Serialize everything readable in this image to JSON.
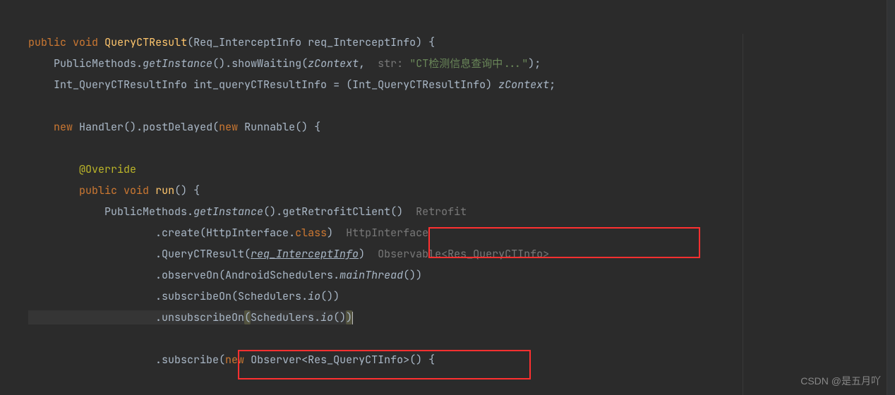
{
  "line1": {
    "kw_public": "public",
    "kw_void": "void",
    "method": "QueryCTResult",
    "param_type": "Req_InterceptInfo",
    "param_name": "req_InterceptInfo",
    "brace": ") {"
  },
  "line2": {
    "cls": "PublicMethods",
    "getInstance": "getInstance",
    "showWaiting": "showWaiting",
    "zContext": "zContext",
    "hint_str": "str:",
    "string_val": "\"CT检测信息查询中...\"",
    "end": ");"
  },
  "line3": {
    "type1": "Int_QueryCTResultInfo",
    "var": "int_queryCTResultInfo",
    "eq": " = ",
    "cast": "(Int_QueryCTResultInfo)",
    "zContext": "zContext",
    "end": ";"
  },
  "line5": {
    "kw_new": "new",
    "Handler": "Handler",
    "postDelayed": "postDelayed",
    "kw_new2": "new",
    "Runnable": "Runnable",
    "end": "() {"
  },
  "line7": {
    "override": "@Override"
  },
  "line8": {
    "kw_public": "public",
    "kw_void": "void",
    "run": "run",
    "end": "() {"
  },
  "line9": {
    "cls": "PublicMethods",
    "getInstance": "getInstance",
    "getRetrofitClient": "getRetrofitClient",
    "hint": "Retrofit"
  },
  "line10": {
    "create": ".create",
    "HttpInterface": "HttpInterface",
    "class_kw": "class",
    "hint": "HttpInterface"
  },
  "line11": {
    "QueryCTResult": ".QueryCTResult",
    "param": "req_InterceptInfo",
    "hint": "Observable<Res_QueryCTInfo>"
  },
  "line12": {
    "observeOn": ".observeOn",
    "AndroidSchedulers": "AndroidSchedulers",
    "mainThread": "mainThread",
    "end": "())"
  },
  "line13": {
    "subscribeOn": ".subscribeOn",
    "Schedulers": "Schedulers",
    "io": "io",
    "end": "())"
  },
  "line14": {
    "unsubscribeOn": ".unsubscribeOn",
    "Schedulers": "Schedulers",
    "io": "io",
    "end": "()"
  },
  "line16": {
    "subscribe": ".subscribe",
    "kw_new": "new",
    "Observer": "Observer",
    "generic": "Res_QueryCTInfo",
    "end": ">() {"
  },
  "watermark": "CSDN @是五月吖",
  "chart_data": null
}
